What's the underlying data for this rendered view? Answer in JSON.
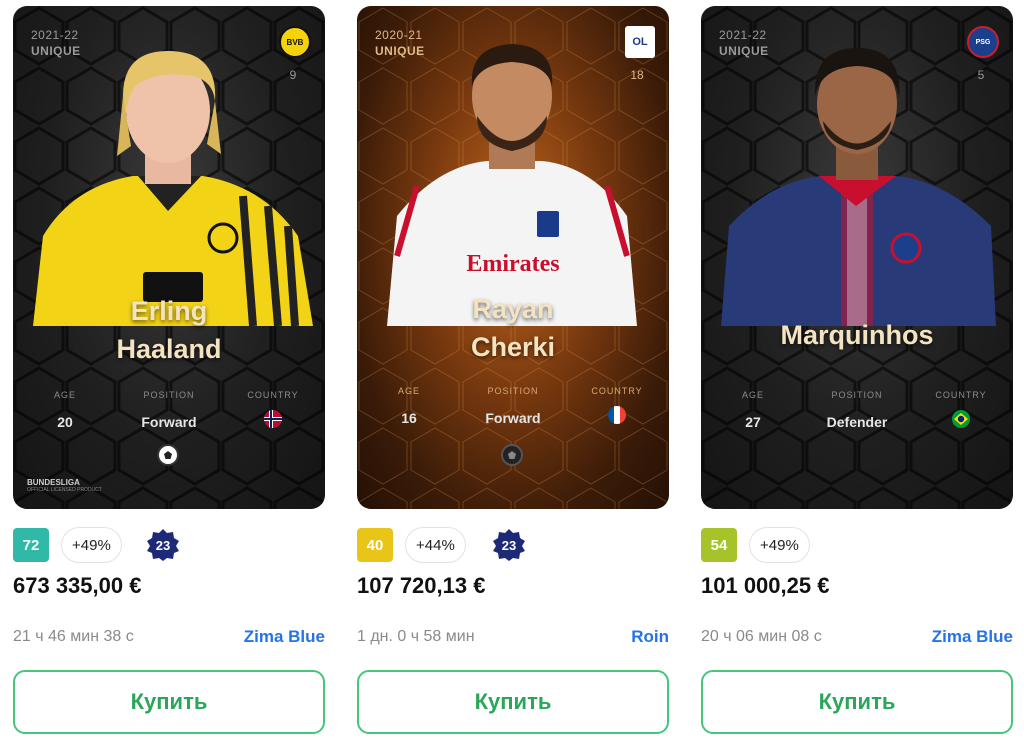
{
  "cards": [
    {
      "season": "2021-22",
      "rarity": "UNIQUE",
      "club_badge": "BVB",
      "shirt_number": "9",
      "first_name": "Erling",
      "last_name": "Haaland",
      "age_label": "AGE",
      "age": "20",
      "position_label": "POSITION",
      "position": "Forward",
      "country_label": "COUNTRY",
      "country_flag": "norway-flag-icon",
      "league": "BUNDESLIGA",
      "league_sub": "OFFICIAL LICENSED PRODUCT",
      "score": "72",
      "score_color": "#2fb9a6",
      "pct": "+49%",
      "seal": "23",
      "price": "673 335,00 €",
      "timer": "21 ч 46 мин 38 с",
      "seller": "Zima Blue",
      "buy_label": "Купить"
    },
    {
      "season": "2020-21",
      "rarity": "UNIQUE",
      "club_badge": "OL",
      "shirt_number": "18",
      "first_name": "Rayan",
      "last_name": "Cherki",
      "age_label": "AGE",
      "age": "16",
      "position_label": "POSITION",
      "position": "Forward",
      "country_label": "COUNTRY",
      "country_flag": "france-flag-icon",
      "score": "40",
      "score_color": "#e9c51a",
      "pct": "+44%",
      "seal": "23",
      "price": "107 720,13 €",
      "timer": "1 дн. 0 ч 58 мин",
      "seller": "Roin",
      "buy_label": "Купить"
    },
    {
      "season": "2021-22",
      "rarity": "UNIQUE",
      "club_badge": "PSG",
      "shirt_number": "5",
      "first_name": "Marquinhos",
      "age_label": "AGE",
      "age": "27",
      "position_label": "POSITION",
      "position": "Defender",
      "country_label": "COUNTRY",
      "country_flag": "brazil-flag-icon",
      "score": "54",
      "score_color": "#a6c42a",
      "pct": "+49%",
      "price": "101 000,25 €",
      "timer": "20 ч 06 мин 08 с",
      "seller": "Zima Blue",
      "buy_label": "Купить"
    }
  ],
  "colors": {
    "seller_link": "#2474e5",
    "buy_border": "#46c67a",
    "seal": "#1e2a78"
  }
}
